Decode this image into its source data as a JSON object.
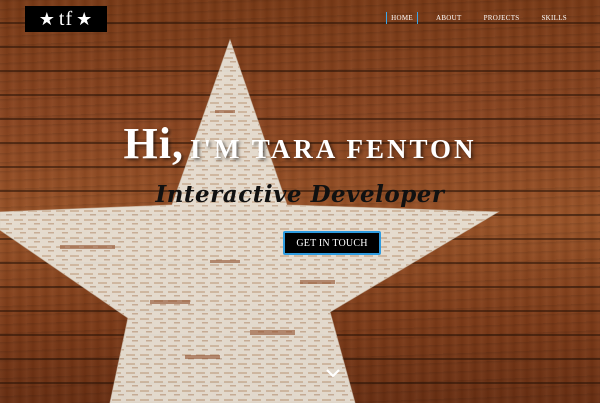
{
  "logo": {
    "star_left": "★",
    "text": "tf",
    "star_right": "★"
  },
  "nav": {
    "items": [
      {
        "label": "HOME",
        "active": true
      },
      {
        "label": "ABOUT",
        "active": false
      },
      {
        "label": "PROJECTS",
        "active": false
      },
      {
        "label": "SKILLS",
        "active": false
      }
    ]
  },
  "hero": {
    "greeting": "Hi,",
    "name_line": "I'M TARA FENTON",
    "subtitle": "Interactive Developer",
    "cta_label": "GET IN TOUCH",
    "scroll_icon": "chevron-down-icon"
  },
  "colors": {
    "accent": "#2d9be0",
    "wood": "#8b4520",
    "star": "#ece7dc",
    "button_bg": "#000000"
  }
}
